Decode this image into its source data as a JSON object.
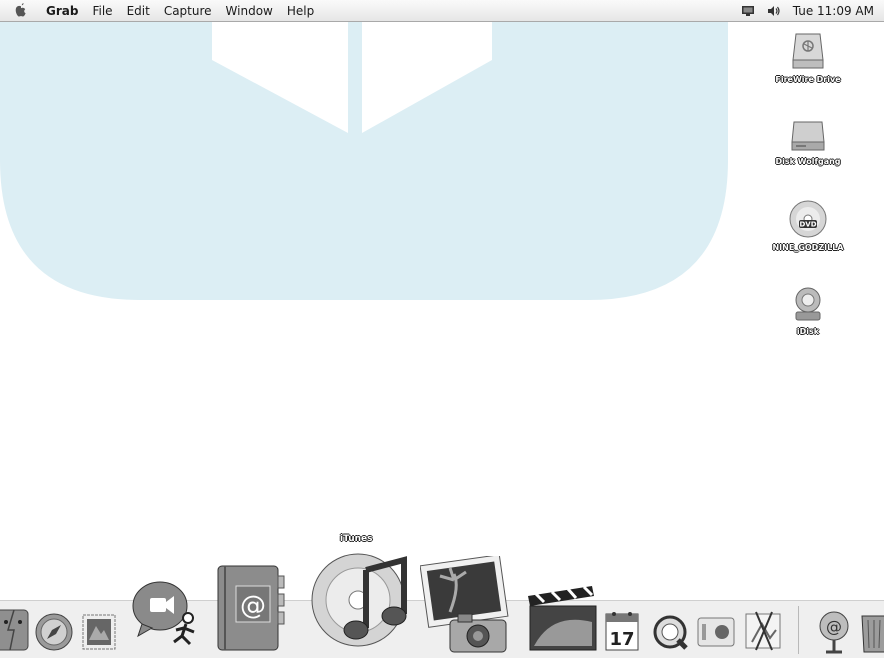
{
  "menubar": {
    "apple_icon": "apple-logo-icon",
    "items": [
      "Grab",
      "File",
      "Edit",
      "Capture",
      "Window",
      "Help"
    ],
    "status_icons": [
      "display-icon",
      "volume-icon"
    ],
    "clock": "Tue 11:09 AM"
  },
  "desktop": {
    "icons": [
      {
        "label": "FireWire Drive",
        "icon": "firewire-drive-icon"
      },
      {
        "label": "Disk Wolfgang",
        "icon": "hard-disk-icon"
      },
      {
        "label": "NINE_GODZILLA",
        "icon": "dvd-disc-icon"
      },
      {
        "label": "iDisk",
        "icon": "idisk-icon"
      }
    ]
  },
  "dock": {
    "hover_label": "iTunes",
    "items": [
      "finder-icon",
      "safari-icon",
      "mail-stamp-icon",
      "ichat-icon",
      "address-book-icon",
      "itunes-icon",
      "iphoto-icon",
      "imovie-icon",
      "ical-icon",
      "quicktime-icon",
      "system-preferences-icon",
      "preview-icon",
      "mail-icon",
      "trash-icon"
    ],
    "calendar_day": "17"
  }
}
